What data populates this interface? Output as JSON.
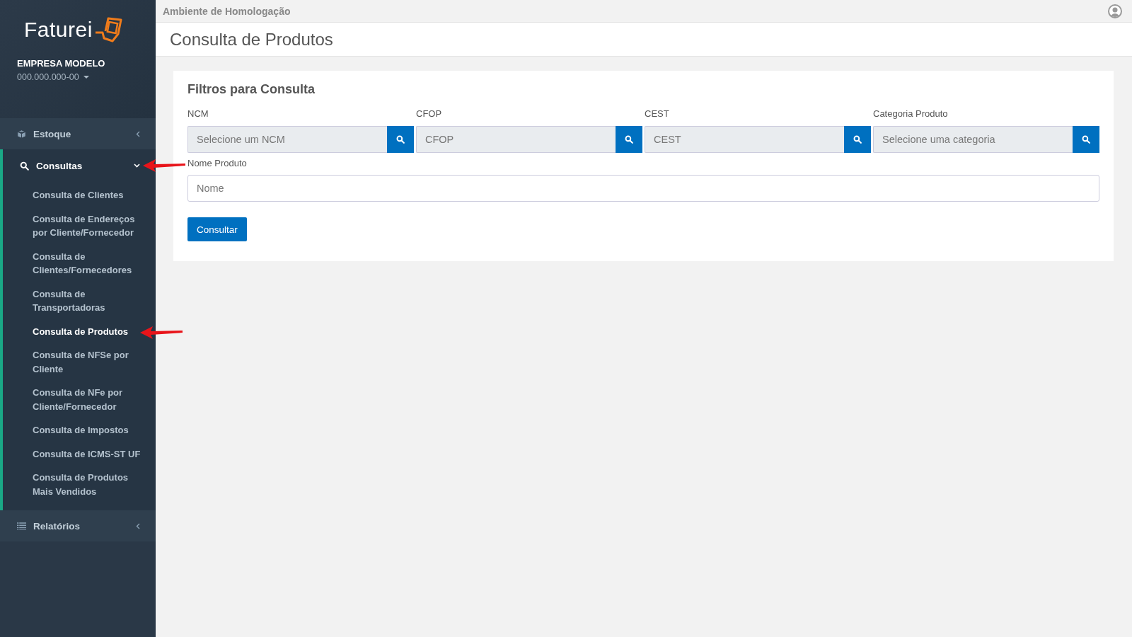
{
  "sidebar": {
    "logo": "Faturei",
    "company": "EMPRESA MODELO",
    "document": "000.000.000-00",
    "menu": [
      {
        "label": "Estoque",
        "expanded": false,
        "marked": false
      },
      {
        "label": "Consultas",
        "expanded": true,
        "marked": true,
        "children": [
          {
            "label": "Consulta de Clientes",
            "selected": false,
            "marked": false
          },
          {
            "label": "Consulta de Endereços por Cliente/Fornecedor",
            "selected": false,
            "marked": false
          },
          {
            "label": "Consulta de Clientes/Fornecedores",
            "selected": false,
            "marked": false
          },
          {
            "label": "Consulta de Transportadoras",
            "selected": false,
            "marked": false
          },
          {
            "label": "Consulta de Produtos",
            "selected": true,
            "marked": true
          },
          {
            "label": "Consulta de NFSe por Cliente",
            "selected": false,
            "marked": false
          },
          {
            "label": "Consulta de NFe por Cliente/Fornecedor",
            "selected": false,
            "marked": false
          },
          {
            "label": "Consulta de Impostos",
            "selected": false,
            "marked": false
          },
          {
            "label": "Consulta de ICMS-ST UF",
            "selected": false,
            "marked": false
          },
          {
            "label": "Consulta de Produtos Mais Vendidos",
            "selected": false,
            "marked": false
          }
        ]
      },
      {
        "label": "Relatórios",
        "expanded": false,
        "marked": false
      }
    ]
  },
  "topbar": {
    "environment": "Ambiente de Homologação"
  },
  "page_title": "Consulta de Produtos",
  "filters": {
    "title": "Filtros para Consulta",
    "lookups": [
      {
        "label": "NCM",
        "placeholder": "Selecione um NCM"
      },
      {
        "label": "CFOP",
        "placeholder": "CFOP"
      },
      {
        "label": "CEST",
        "placeholder": "CEST"
      },
      {
        "label": "Categoria Produto",
        "placeholder": "Selecione uma categoria"
      }
    ],
    "name_field": {
      "label": "Nome Produto",
      "placeholder": "Nome"
    },
    "submit": "Consultar"
  }
}
